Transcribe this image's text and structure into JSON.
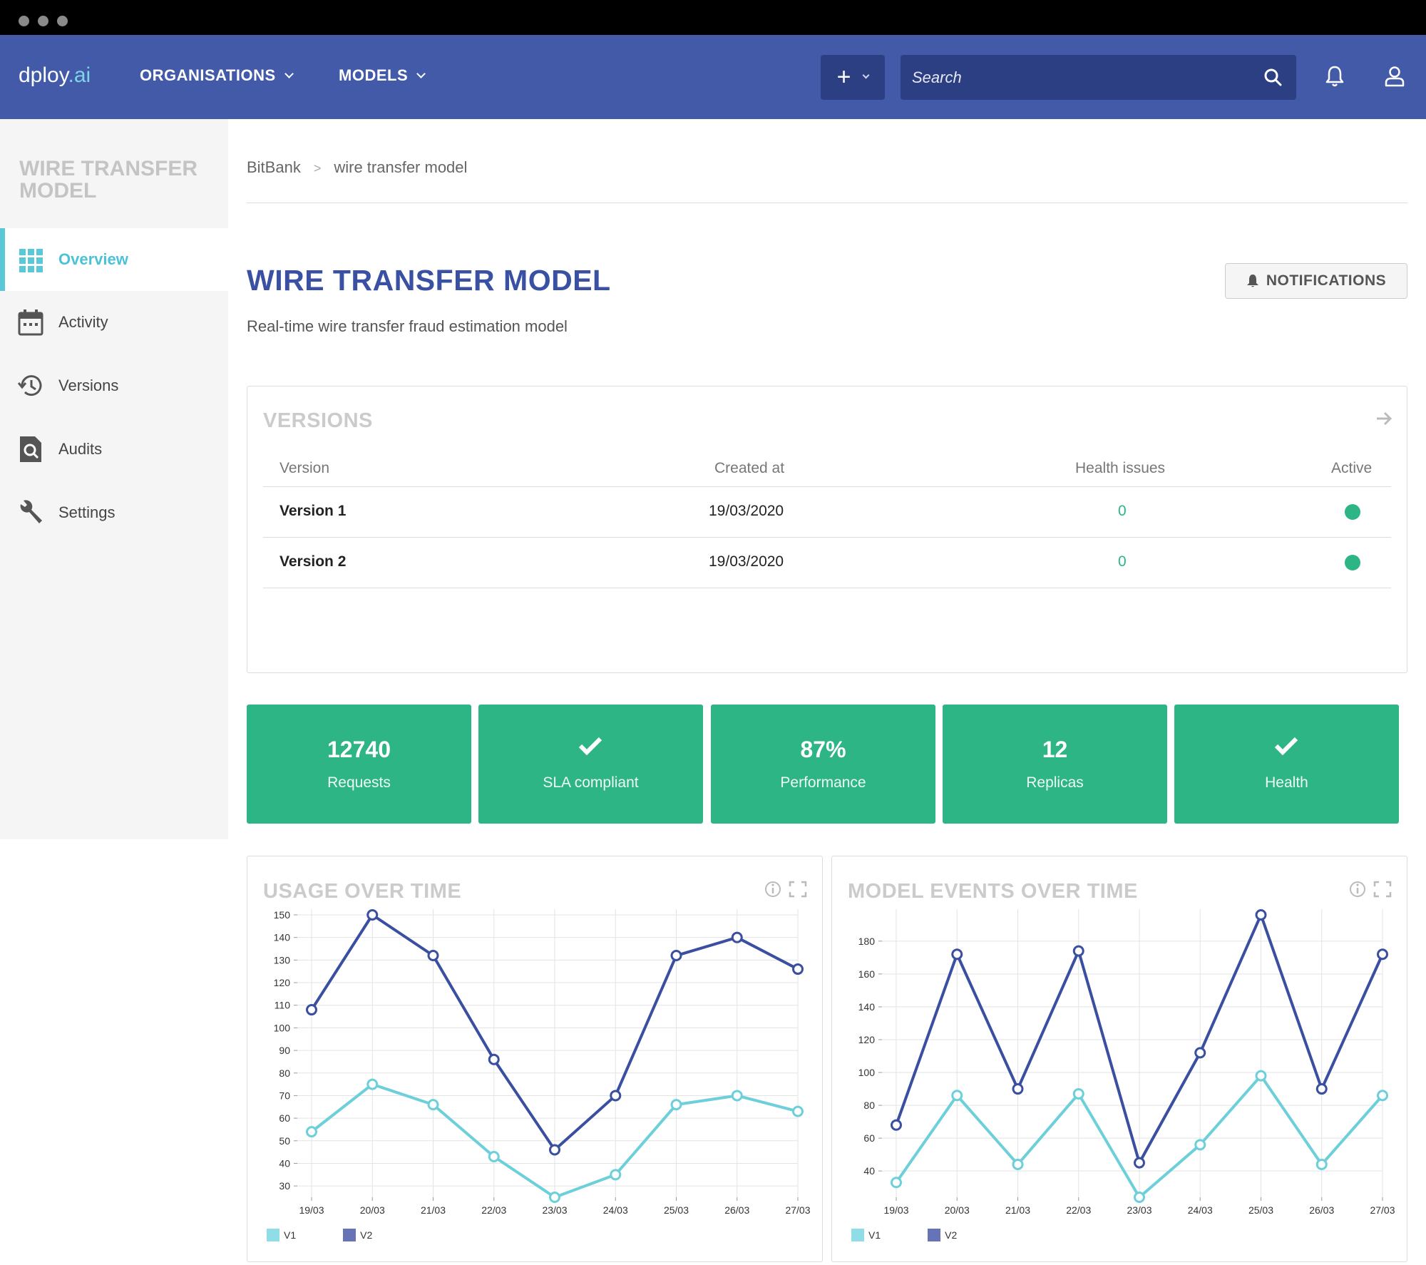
{
  "app": {
    "logo_main": "dploy",
    "logo_suffix": ".ai"
  },
  "topnav": {
    "menus": [
      {
        "label": "ORGANISATIONS"
      },
      {
        "label": "MODELS"
      }
    ],
    "add_label": "+",
    "search_placeholder": "Search"
  },
  "sidebar": {
    "title": "WIRE TRANSFER MODEL",
    "items": [
      {
        "label": "Overview",
        "icon": "grid-icon",
        "active": true
      },
      {
        "label": "Activity",
        "icon": "calendar-icon",
        "active": false
      },
      {
        "label": "Versions",
        "icon": "history-icon",
        "active": false
      },
      {
        "label": "Audits",
        "icon": "audit-search-icon",
        "active": false
      },
      {
        "label": "Settings",
        "icon": "wrench-icon",
        "active": false
      }
    ]
  },
  "breadcrumb": {
    "org": "BitBank",
    "separator": ">",
    "model": "wire transfer model"
  },
  "page": {
    "title": "WIRE TRANSFER MODEL",
    "subtitle": "Real-time wire transfer fraud estimation model",
    "notifications_label": "NOTIFICATIONS"
  },
  "versions": {
    "title": "VERSIONS",
    "columns": [
      "Version",
      "Created at",
      "Health issues",
      "Active"
    ],
    "rows": [
      {
        "version": "Version 1",
        "created_at": "19/03/2020",
        "health_issues": "0",
        "active": true
      },
      {
        "version": "Version 2",
        "created_at": "19/03/2020",
        "health_issues": "0",
        "active": true
      }
    ]
  },
  "stats": [
    {
      "value": "12740",
      "label": "Requests",
      "check": false
    },
    {
      "value": "",
      "label": "SLA compliant",
      "check": true
    },
    {
      "value": "87%",
      "label": "Performance",
      "check": false
    },
    {
      "value": "12",
      "label": "Replicas",
      "check": false
    },
    {
      "value": "",
      "label": "Health",
      "check": true
    }
  ],
  "colors": {
    "accent": "#425aa8",
    "green": "#2db586",
    "v1": "#6ccfd9",
    "v2": "#3a4fa0"
  },
  "chart_data": [
    {
      "type": "line",
      "title": "USAGE OVER TIME",
      "categories": [
        "19/03",
        "20/03",
        "21/03",
        "22/03",
        "23/03",
        "24/03",
        "25/03",
        "26/03",
        "27/03"
      ],
      "yticks": [
        30,
        40,
        50,
        60,
        70,
        80,
        90,
        100,
        110,
        120,
        130,
        140,
        150
      ],
      "ylim": [
        25,
        150
      ],
      "series": [
        {
          "name": "V1",
          "values": [
            54,
            75,
            66,
            43,
            25,
            35,
            66,
            70,
            63
          ]
        },
        {
          "name": "V2",
          "values": [
            108,
            150,
            132,
            86,
            46,
            70,
            132,
            140,
            126
          ]
        }
      ],
      "legend": "bottom-left",
      "grid": true
    },
    {
      "type": "line",
      "title": "MODEL EVENTS OVER TIME",
      "categories": [
        "19/03",
        "20/03",
        "21/03",
        "22/03",
        "23/03",
        "24/03",
        "25/03",
        "26/03",
        "27/03"
      ],
      "yticks": [
        40,
        60,
        80,
        100,
        120,
        140,
        160,
        180
      ],
      "ylim": [
        24,
        196
      ],
      "series": [
        {
          "name": "V1",
          "values": [
            33,
            86,
            44,
            87,
            24,
            56,
            98,
            44,
            86
          ]
        },
        {
          "name": "V2",
          "values": [
            68,
            172,
            90,
            174,
            45,
            112,
            196,
            90,
            172
          ]
        }
      ],
      "legend": "bottom-left",
      "grid": true
    }
  ]
}
